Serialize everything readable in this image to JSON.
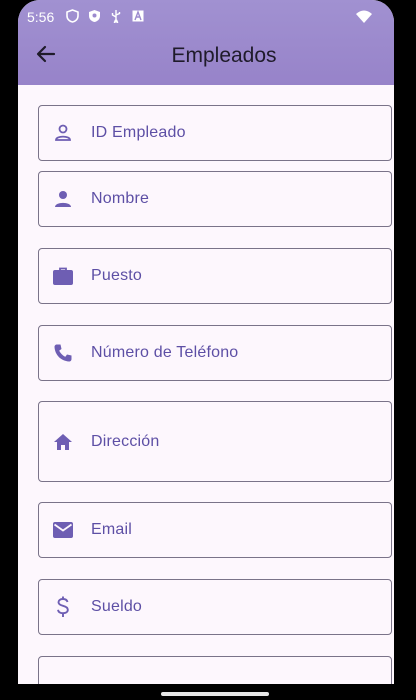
{
  "status_bar": {
    "time": "5:56",
    "icons": [
      "shield-icon",
      "shield-check-icon",
      "usb-icon",
      "notification-a-icon",
      "wifi-icon"
    ]
  },
  "app_bar": {
    "title": "Empleados",
    "back_icon": "arrow-back-icon"
  },
  "form": {
    "fields": [
      {
        "label": "ID Empleado",
        "icon": "person-outline-icon"
      },
      {
        "label": "Nombre",
        "icon": "person-icon"
      },
      {
        "label": "Puesto",
        "icon": "work-icon"
      },
      {
        "label": "Número de Teléfono",
        "icon": "phone-icon"
      },
      {
        "label": "Dirección",
        "icon": "home-icon"
      },
      {
        "label": "Email",
        "icon": "email-icon"
      },
      {
        "label": "Sueldo",
        "icon": "dollar-icon"
      }
    ]
  },
  "colors": {
    "header": "#9c8ace",
    "accent": "#5d4fa5",
    "icon": "#6e5eb3",
    "background": "#fdf7fd",
    "border": "#7a7389"
  }
}
